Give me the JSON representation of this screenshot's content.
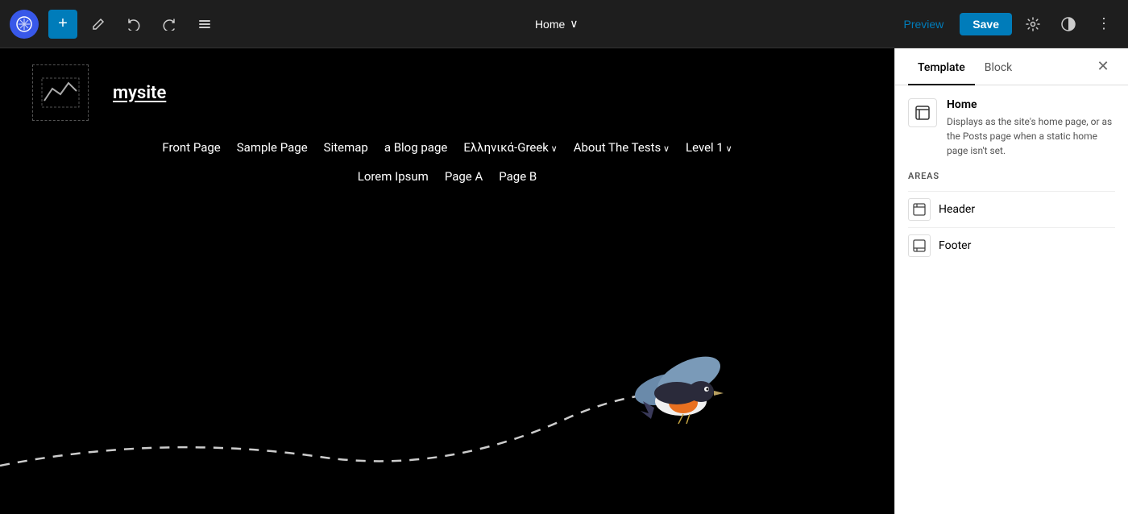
{
  "toolbar": {
    "wp_logo": "W",
    "add_label": "+",
    "edit_label": "✏",
    "undo_label": "↩",
    "redo_label": "↪",
    "tools_label": "≡",
    "page_title": "Home",
    "page_title_chevron": "∨",
    "preview_label": "Preview",
    "save_label": "Save",
    "settings_icon": "⚙",
    "style_icon": "◑",
    "more_icon": "⋮"
  },
  "canvas": {
    "site_name": "mysite",
    "nav_items": [
      {
        "label": "Front Page",
        "has_submenu": false
      },
      {
        "label": "Sample Page",
        "has_submenu": false
      },
      {
        "label": "Sitemap",
        "has_submenu": false
      },
      {
        "label": "a Blog page",
        "has_submenu": false
      },
      {
        "label": "Ελληνικά-Greek",
        "has_submenu": true
      },
      {
        "label": "About The Tests",
        "has_submenu": true
      },
      {
        "label": "Level 1",
        "has_submenu": true
      }
    ],
    "nav_row2": [
      {
        "label": "Lorem Ipsum",
        "has_submenu": false
      },
      {
        "label": "Page A",
        "has_submenu": false
      },
      {
        "label": "Page B",
        "has_submenu": false
      }
    ]
  },
  "panel": {
    "tab_template": "Template",
    "tab_block": "Block",
    "active_tab": "Template",
    "home_title": "Home",
    "home_description": "Displays as the site's home page, or as the Posts page when a static home page isn't set.",
    "areas_label": "AREAS",
    "areas": [
      {
        "name": "Header",
        "icon": "header"
      },
      {
        "name": "Footer",
        "icon": "footer"
      }
    ]
  }
}
